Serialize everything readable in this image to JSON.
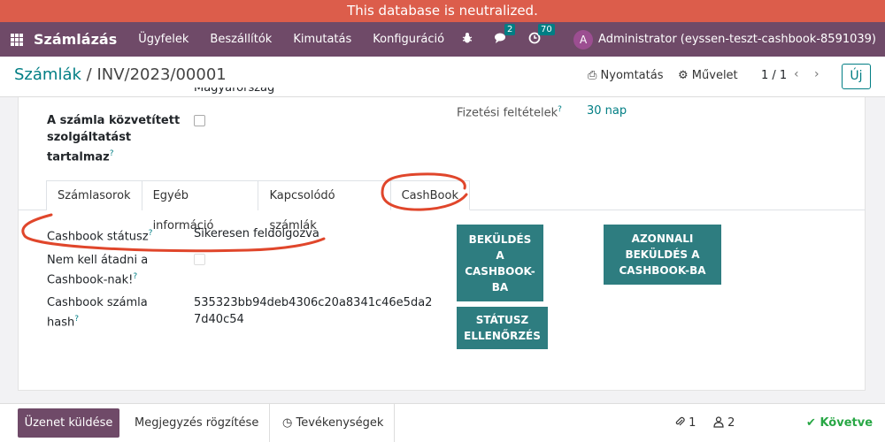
{
  "banner": {
    "text": "This database is neutralized."
  },
  "navbar": {
    "app_name": "Számlázás",
    "menu": [
      "Ügyfelek",
      "Beszállítók",
      "Kimutatás",
      "Konfiguráció"
    ],
    "messages_count": "2",
    "activities_count": "70",
    "avatar_letter": "A",
    "user": "Administrator (eyssen-teszt-cashbook-8591039)"
  },
  "control": {
    "breadcrumb_parent": "Számlák",
    "breadcrumb_sep": "/",
    "breadcrumb_current": "INV/2023/00001",
    "print_label": "Nyomtatás",
    "action_label": "Művelet",
    "pager": "1 / 1",
    "new_label": "Új"
  },
  "form": {
    "cutoff_text": "Magyarország",
    "intermediated_label_1": "A számla közvetített",
    "intermediated_label_2": "szolgáltatást",
    "intermediated_label_3": "tartalmaz",
    "payment_terms_label": "Fizetési feltételek",
    "payment_terms_value": "30 nap",
    "help_mark": "?"
  },
  "tabs": [
    "Számlasorok",
    "Egyéb információ",
    "Kapcsolódó számlák",
    "CashBook"
  ],
  "cashbook": {
    "status_label": "Cashbook státusz",
    "status_value": "Sikeresen feldolgozva",
    "no_transfer_label_1": "Nem kell átadni a",
    "no_transfer_label_2": "Cashbook-nak!",
    "hash_label_1": "Cashbook számla",
    "hash_label_2": "hash",
    "hash_value_1": "535323bb94deb4306c20a8341c46e5da2",
    "hash_value_2": "7d40c54",
    "send_btn": [
      "BEKÜLDÉS",
      "A",
      "CASHBOOK-",
      "BA"
    ],
    "status_btn": [
      "STÁTUSZ",
      "ELLENŐRZÉS"
    ],
    "instant_btn": [
      "AZONNALI",
      "BEKÜLDÉS A",
      "CASHBOOK-BA"
    ]
  },
  "chatter": {
    "send_message": "Üzenet küldése",
    "log_note": "Megjegyzés rögzítése",
    "activities": "Tevékenységek",
    "attachments_count": "1",
    "followers_count": "2",
    "follow_label": "Követve"
  },
  "colors": {
    "brand": "#6f4a68",
    "teal": "#2e7d80",
    "banner": "#dc5d4b",
    "annotation": "#e0462b"
  }
}
